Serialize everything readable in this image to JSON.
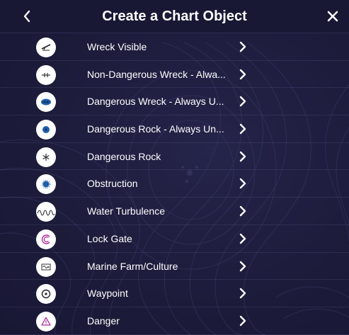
{
  "header": {
    "title": "Create a Chart Object",
    "back_icon": "chevron-left-icon",
    "close_icon": "close-icon"
  },
  "items": [
    {
      "label": "Wreck Visible",
      "icon": "wreck-visible-icon"
    },
    {
      "label": "Non-Dangerous Wreck - Alwa...",
      "icon": "non-dangerous-wreck-icon"
    },
    {
      "label": "Dangerous Wreck - Always U...",
      "icon": "dangerous-wreck-icon"
    },
    {
      "label": "Dangerous Rock - Always Un...",
      "icon": "dangerous-rock-underwater-icon"
    },
    {
      "label": "Dangerous Rock",
      "icon": "dangerous-rock-icon"
    },
    {
      "label": "Obstruction",
      "icon": "obstruction-icon"
    },
    {
      "label": "Water Turbulence",
      "icon": "water-turbulence-icon"
    },
    {
      "label": "Lock Gate",
      "icon": "lock-gate-icon"
    },
    {
      "label": "Marine Farm/Culture",
      "icon": "marine-farm-icon"
    },
    {
      "label": "Waypoint",
      "icon": "waypoint-icon"
    },
    {
      "label": "Danger",
      "icon": "danger-icon"
    }
  ],
  "colors": {
    "background": "#1f1e3f",
    "header": "#181734",
    "text": "#ffffff",
    "accent_blue": "#1e5fa8",
    "accent_magenta": "#b0329a"
  }
}
